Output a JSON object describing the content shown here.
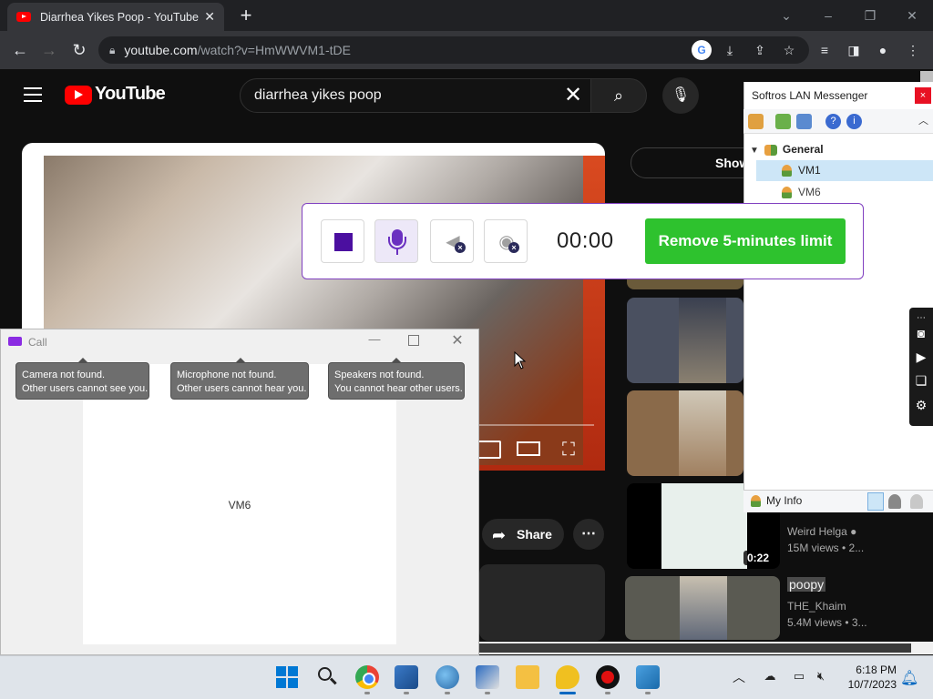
{
  "browser": {
    "tab_title": "Diarrhea Yikes Poop - YouTube",
    "tab_close": "✕",
    "new_tab": "+",
    "url_domain": "youtube.com",
    "url_path": "/watch?v=HmWWVM1-tDE"
  },
  "youtube": {
    "logo_text": "YouTube",
    "search_query": "diarrhea yikes poop",
    "show_button": "Show",
    "share_label": "Share",
    "recommendations": [
      {
        "duration": "0:22",
        "channel": "Weird Helga",
        "views": "15M views  •  2..."
      },
      {
        "title": "poopy",
        "channel": "THE_Khaim",
        "views": "5.4M views  •  3..."
      }
    ]
  },
  "recorder": {
    "timer": "00:00",
    "remove_limit": "Remove 5-minutes limit"
  },
  "call_window": {
    "title": "Call",
    "peer": "VM6",
    "tips": [
      {
        "line1": "Camera not found.",
        "line2": "Other users cannot see you."
      },
      {
        "line1": "Microphone not found.",
        "line2": "Other users cannot hear you."
      },
      {
        "line1": "Speakers not found.",
        "line2": "You cannot hear other users."
      }
    ]
  },
  "messenger": {
    "title": "Softros LAN Messenger",
    "close": "×",
    "group": "General",
    "users": [
      "VM1",
      "VM6"
    ],
    "my_info": "My Info"
  },
  "taskbar": {
    "time": "6:18 PM",
    "date": "10/7/2023"
  },
  "colors": {
    "youtube_red": "#ff0000",
    "recorder_accent": "#4b0fa0",
    "remove_button": "#2ec22e",
    "selected_user": "#cde6f7"
  }
}
